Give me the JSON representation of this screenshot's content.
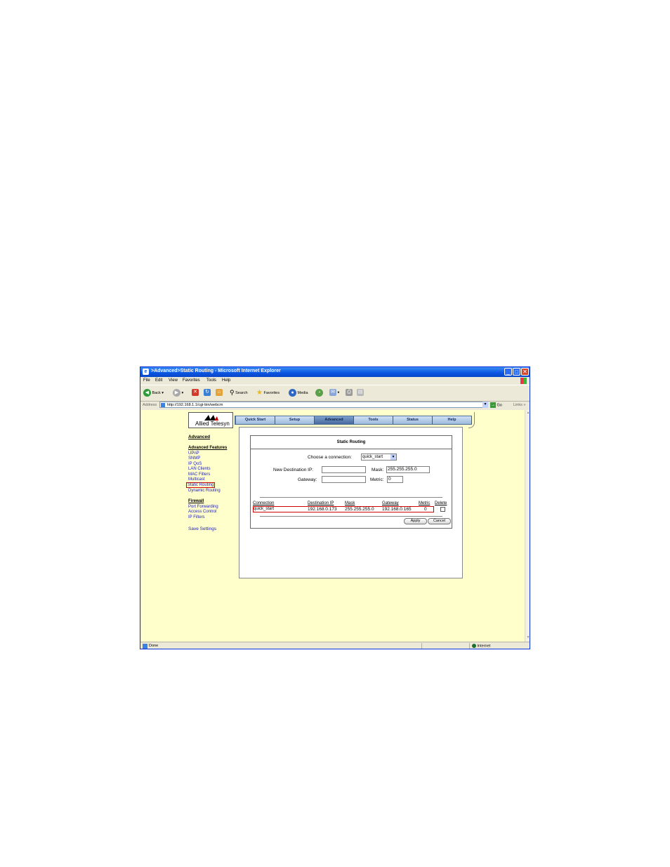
{
  "window": {
    "title": ">Advanced>Static Routing - Microsoft Internet Explorer"
  },
  "menu": [
    "File",
    "Edit",
    "View",
    "Favorites",
    "Tools",
    "Help"
  ],
  "toolbar": {
    "back": "Back",
    "search": "Search",
    "favorites": "Favorites",
    "media": "Media"
  },
  "address": {
    "label": "Address",
    "url": "http://192.168.1.1/cgi-bin/webcm",
    "go": "Go",
    "links": "Links"
  },
  "brand": "Allied Telesyn",
  "nav": [
    "Quick Start",
    "Setup",
    "Advanced",
    "Tools",
    "Status",
    "Help"
  ],
  "nav_active": "Advanced",
  "sidebar": {
    "advanced": "Advanced",
    "features_heading": "Advanced Features",
    "features": [
      "UPnP",
      "SNMP",
      "IP QoS",
      "LAN Clients",
      "MAC Filters",
      "Multicast",
      "Static Routing",
      "Dynamic Routing"
    ],
    "firewall_heading": "Firewall",
    "firewall": [
      "Port Forwarding",
      "Access Control",
      "IP Filters"
    ],
    "save": "Save Settings"
  },
  "form": {
    "title": "Static Routing",
    "choose_label": "Choose a connection:",
    "connection_value": "quick_start",
    "dest_label": "New Destination IP:",
    "dest_value": "",
    "mask_label": "Mask:",
    "mask_value": "255.255.255.0",
    "gateway_label": "Gateway:",
    "gateway_value": "",
    "metric_label": "Metric:",
    "metric_value": "0"
  },
  "table": {
    "headers": [
      "Connection",
      "Destination IP",
      "Mask",
      "Gateway",
      "Metric",
      "Delete"
    ],
    "rows": [
      [
        "quick_start",
        "192.168.0.173",
        "255.255.255.0",
        "192.168.0.165",
        "0"
      ]
    ]
  },
  "buttons": {
    "apply": "Apply",
    "cancel": "Cancel"
  },
  "status": {
    "text": "Done",
    "zone": "Internet"
  }
}
